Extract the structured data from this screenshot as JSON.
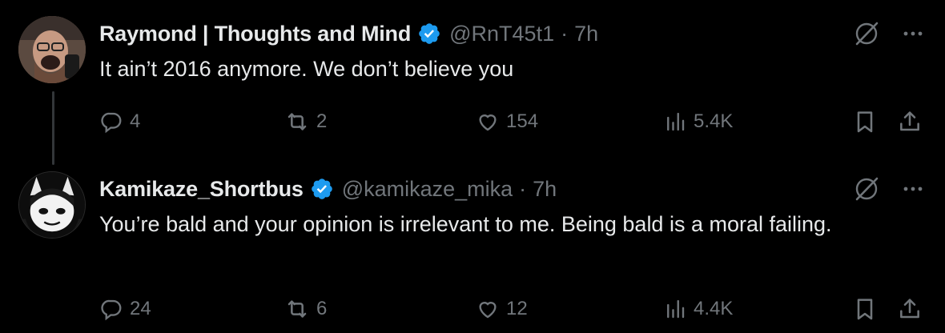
{
  "tweets": [
    {
      "author": {
        "name": "Raymond | Thoughts and Mind",
        "handle": "@RnT45t1",
        "verified": true
      },
      "time": "7h",
      "separator": "·",
      "text": "It ain’t 2016 anymore. We don’t believe you",
      "stats": {
        "replies": "4",
        "reposts": "2",
        "likes": "154",
        "views": "5.4K"
      }
    },
    {
      "author": {
        "name": "Kamikaze_Shortbus",
        "handle": "@kamikaze_mika",
        "verified": true
      },
      "time": "7h",
      "separator": "·",
      "text": "You’re bald and your opinion is irrelevant to me. Being bald is a moral failing.",
      "stats": {
        "replies": "24",
        "reposts": "6",
        "likes": "12",
        "views": "4.4K"
      }
    }
  ],
  "colors": {
    "background": "#000000",
    "text_primary": "#e7e9ea",
    "text_secondary": "#71767b",
    "verified_blue": "#1d9bf0",
    "thread_line": "#333639"
  },
  "icons": [
    "reply-icon",
    "repost-icon",
    "like-icon",
    "views-icon",
    "bookmark-icon",
    "share-icon",
    "grok-icon",
    "more-icon",
    "verified-badge-icon"
  ]
}
